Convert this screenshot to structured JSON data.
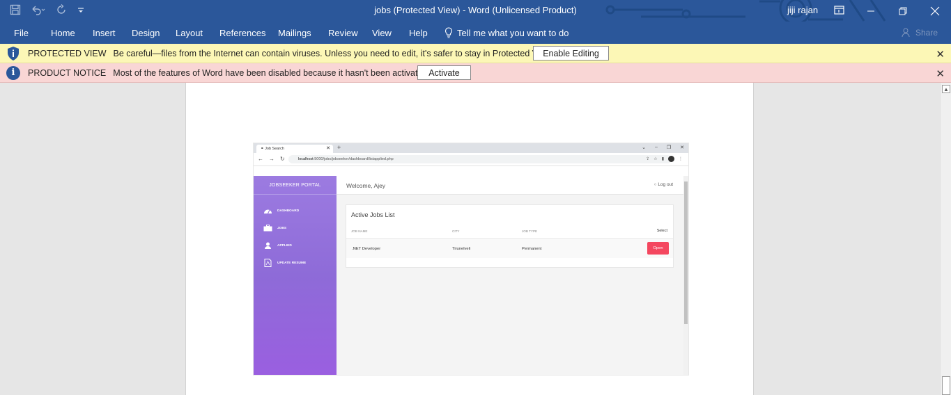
{
  "titlebar": {
    "title": "jobs (Protected View)  -  Word (Unlicensed Product)",
    "user_name": "jiji rajan",
    "accent_color": "#2b579a"
  },
  "ribbon": {
    "tabs": [
      "File",
      "Home",
      "Insert",
      "Design",
      "Layout",
      "References",
      "Mailings",
      "Review",
      "View",
      "Help"
    ],
    "tell_me": "Tell me what you want to do",
    "share": "Share"
  },
  "protected_view": {
    "title": "PROTECTED VIEW",
    "message": "Be careful—files from the Internet can contain viruses. Unless you need to edit, it's safer to stay in Protected View.",
    "button": "Enable Editing",
    "color": "#fcf7b6"
  },
  "product_notice": {
    "title": "PRODUCT NOTICE",
    "message": "Most of the features of Word have been disabled because it hasn't been activated.",
    "button": "Activate",
    "color": "#f9d6d5"
  },
  "embedded_screenshot": {
    "browser": {
      "tab_title": "Job Search",
      "url_host": "localhost",
      "url_rest": ":5000/jobs/jobseeker/dashboard/listapplied.php"
    },
    "app": {
      "brand": "JOBSEEKER PORTAL",
      "welcome": "Welcome, Ajey",
      "logout": "Log out",
      "nav": [
        "DASHBOARD",
        "JOBS",
        "APPLIED",
        "UPDATE RESUME"
      ],
      "card_title": "Active Jobs List",
      "columns": [
        "JOB NAME",
        "CITY",
        "JOB TYPE",
        "Select"
      ],
      "rows": [
        {
          "job_name": ".NET Developer",
          "city": "Tirunelveli",
          "job_type": "Permanent",
          "action": "Open"
        }
      ],
      "sidebar_color": "#9c7be1",
      "button_color": "#f4475f"
    }
  }
}
